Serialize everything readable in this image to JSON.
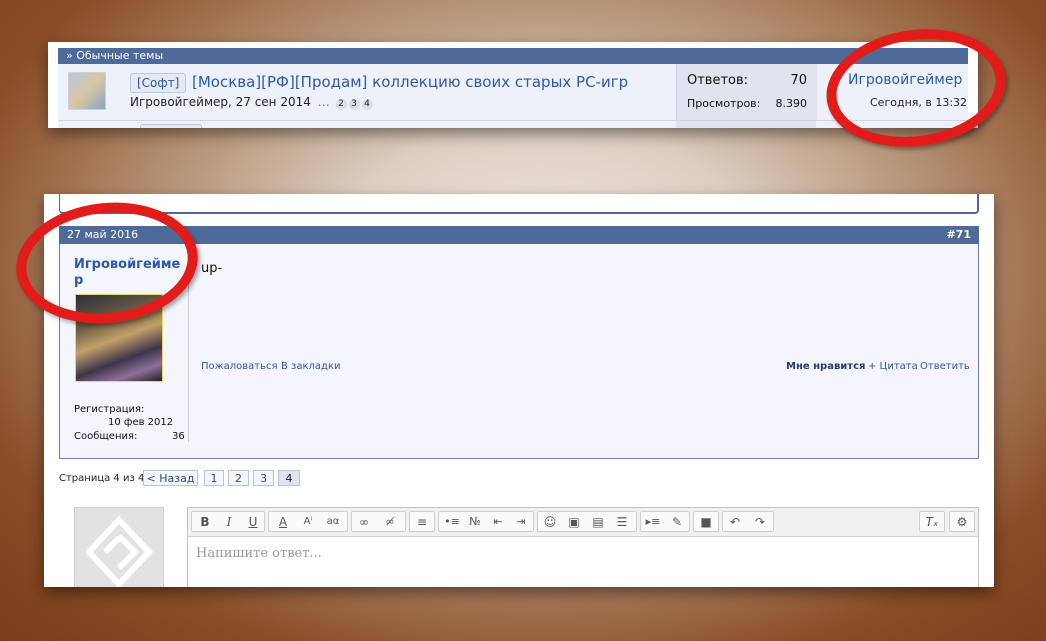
{
  "thread_list": {
    "category": "» Обычные темы",
    "thread": {
      "prefix": "[Софт]",
      "title": "[Москва][РФ][Продам] коллекцию своих старых PC-игр",
      "author_date": "Игровойгеймер, 27 сен 2014",
      "ellipsis": "…",
      "pages": [
        "2",
        "3",
        "4"
      ],
      "replies_label": "Ответов:",
      "replies": "70",
      "views_label": "Просмотров:",
      "views": "8.390",
      "last_user": "Игровойгеймер",
      "last_time": "Сегодня, в 13:32"
    }
  },
  "post": {
    "date": "27 май 2016",
    "number": "#71",
    "author": "Игровойгеймер",
    "reg_label": "Регистрация:",
    "reg_date": "10 фев 2012",
    "msgs_label": "Сообщения:",
    "msgs": "36",
    "text": "up-",
    "left_links": [
      "Пожаловаться",
      "В закладки"
    ],
    "right_links": [
      "Мне нравится",
      "+ Цитата",
      "Ответить"
    ]
  },
  "pagination": {
    "label": "Страница 4 из 4",
    "back": "< Назад",
    "pages": [
      "1",
      "2",
      "3",
      "4"
    ],
    "current": "4"
  },
  "editor": {
    "placeholder": "Напишите ответ...",
    "toolbar_icons": [
      "bold-icon",
      "italic-icon",
      "underline-icon",
      "text-color-icon",
      "font-size-icon",
      "font-family-icon",
      "link-icon",
      "unlink-icon",
      "align-icon",
      "bullet-list-icon",
      "numbered-list-icon",
      "outdent-icon",
      "indent-icon",
      "smilies-icon",
      "image-icon",
      "media-icon",
      "quote-icon",
      "spoiler-icon",
      "draft-icon",
      "save-icon",
      "undo-icon",
      "redo-icon",
      "remove-format-icon",
      "toggle-bbcode-icon"
    ]
  },
  "colors": {
    "accent": "#4e6a99",
    "link": "#2a5aa8",
    "highlight": "#e21b1b"
  }
}
